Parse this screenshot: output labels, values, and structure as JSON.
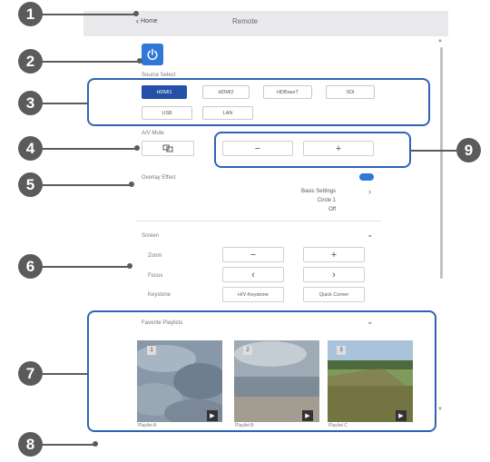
{
  "header": {
    "back_label": "Home",
    "title": "Remote"
  },
  "source_select": {
    "label": "Source Select",
    "row1": [
      "HDMI1",
      "HDMI2",
      "HDBaseT",
      "SDI"
    ],
    "row2": [
      "USB",
      "LAN"
    ],
    "active": "HDMI1"
  },
  "av_mute": {
    "label": "A/V Mute",
    "icon": "av-mute-icon",
    "minus": "−",
    "plus": "+"
  },
  "overlay": {
    "label": "Overlay Effect",
    "settings_title": "Basic Settings",
    "settings_line2": "Circle 1",
    "settings_line3": "Off"
  },
  "screen": {
    "label": "Screen",
    "zoom_label": "Zoom",
    "zoom_minus": "−",
    "zoom_plus": "+",
    "focus_label": "Focus",
    "focus_left": "‹",
    "focus_right": "›",
    "keystone_label": "Keystone",
    "hv_keystone": "H/V-Keystone",
    "quick_corner": "Quick Corner"
  },
  "favorites": {
    "label": "Favorite Playlists",
    "items": [
      {
        "number": "1",
        "name": "Playlist A"
      },
      {
        "number": "2",
        "name": "Playlist B"
      },
      {
        "number": "3",
        "name": "Playlist C"
      }
    ]
  },
  "callouts": [
    "1",
    "2",
    "3",
    "4",
    "5",
    "6",
    "7",
    "8",
    "9"
  ],
  "colors": {
    "accent": "#2f78d6",
    "active_source": "#2351a8",
    "highlight_box": "#2e64b6",
    "callout": "#5b5b5b"
  }
}
